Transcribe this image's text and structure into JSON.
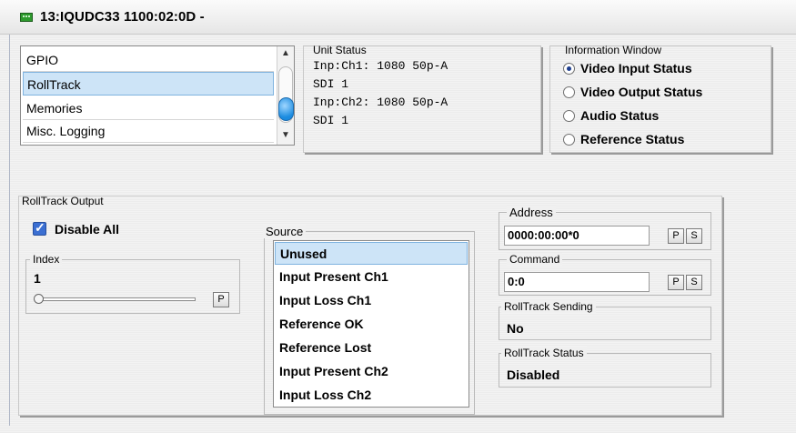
{
  "window": {
    "title": "13:IQUDC33  1100:02:0D  -"
  },
  "menu_list": {
    "items": [
      "GPIO",
      "RollTrack",
      "Memories",
      "Misc. Logging"
    ],
    "selected_index": 1
  },
  "unit_status": {
    "label": "Unit Status",
    "lines": [
      "Inp:Ch1: 1080 50p-A",
      "SDI 1",
      "Inp:Ch2: 1080 50p-A",
      "SDI 1"
    ]
  },
  "info_window": {
    "label": "Information Window",
    "options": [
      "Video Input Status",
      "Video Output Status",
      "Audio Status",
      "Reference Status"
    ],
    "selected_index": 0
  },
  "rolltrack_output": {
    "label": "RollTrack Output",
    "disable_all_label": "Disable All",
    "disable_all_checked": true,
    "index": {
      "label": "Index",
      "value": "1",
      "p_button": "P"
    },
    "source": {
      "label": "Source",
      "items": [
        "Unused",
        "Input Present Ch1",
        "Input Loss Ch1",
        "Reference OK",
        "Reference Lost",
        "Input Present Ch2",
        "Input Loss Ch2"
      ],
      "selected_index": 0
    },
    "address": {
      "label": "Address",
      "value": "0000:00:00*0",
      "p_button": "P",
      "s_button": "S"
    },
    "command": {
      "label": "Command",
      "value": "0:0",
      "p_button": "P",
      "s_button": "S"
    },
    "sending": {
      "label": "RollTrack Sending",
      "value": "No"
    },
    "status": {
      "label": "RollTrack Status",
      "value": "Disabled"
    }
  },
  "colors": {
    "selection": "#cde4f7",
    "checkbox": "#3b6fd2",
    "scroll_thumb": "#1a8be0"
  }
}
